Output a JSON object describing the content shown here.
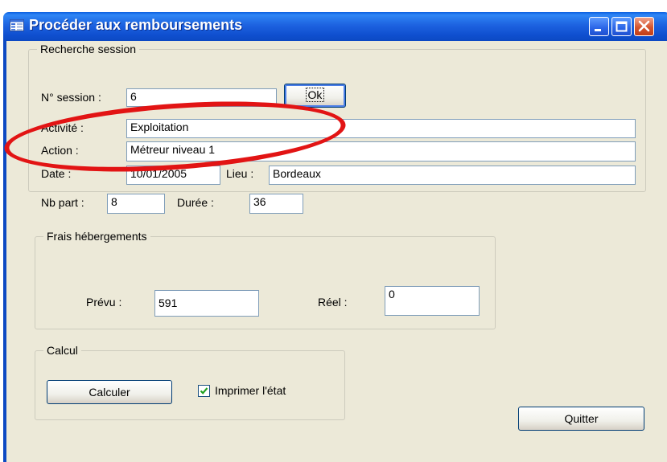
{
  "window": {
    "title": "Procéder aux remboursements",
    "controls": [
      "minimize-icon",
      "maximize-icon",
      "close-icon"
    ]
  },
  "recherche_session": {
    "legend": "Recherche session",
    "session_label": "N° session :",
    "session_value": "6",
    "ok_label": "Ok",
    "activite_label": "Activité :",
    "activite_value": "Exploitation",
    "action_label": "Action :",
    "action_value": "Métreur niveau 1",
    "date_label": "Date :",
    "date_value": "10/01/2005",
    "lieu_label": "Lieu :",
    "lieu_value": "Bordeaux",
    "nbpart_label": "Nb part :",
    "nbpart_value": "8",
    "duree_label": "Durée :",
    "duree_value": "36"
  },
  "frais": {
    "legend": "Frais hébergements",
    "prevu_label": "Prévu :",
    "prevu_value": "591",
    "reel_label": "Réel :",
    "reel_value": "0"
  },
  "calcul": {
    "legend": "Calcul",
    "calculer_label": "Calculer",
    "imprimer_label": "Imprimer l'état",
    "imprimer_checked": true
  },
  "quitter_label": "Quitter",
  "colors": {
    "titlebar": "#0c49c3",
    "client_bg": "#ece9d8",
    "annotation": "#e21414"
  }
}
